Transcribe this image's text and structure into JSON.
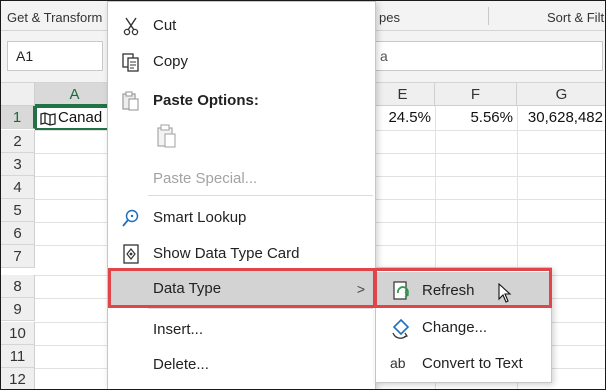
{
  "ribbon": {
    "groups": [
      "Get & Transform",
      "pes",
      "Sort & Filt"
    ]
  },
  "formula_bar": {
    "name_box": "A1",
    "formula_fragment": "a"
  },
  "sheet": {
    "columns": [
      "A",
      "E",
      "F",
      "G"
    ],
    "rows": [
      "1",
      "2",
      "3",
      "4",
      "5",
      "6",
      "7",
      "8",
      "9",
      "10",
      "11",
      "12"
    ],
    "active_cell": "A1",
    "row1": {
      "A": "Canad",
      "E": "24.5%",
      "F": "5.56%",
      "G": "30,628,482"
    }
  },
  "context_menu": {
    "items": [
      {
        "label": "Cut",
        "icon": "scissors-icon"
      },
      {
        "label": "Copy",
        "icon": "copy-icon"
      },
      {
        "label": "Paste Options:",
        "icon": "paste-icon"
      },
      {
        "label": "Paste Special...",
        "icon": "paste-special-icon"
      },
      {
        "label": "Smart Lookup",
        "icon": "smart-lookup-icon"
      },
      {
        "label": "Show Data Type Card",
        "icon": "data-type-card-icon"
      },
      {
        "label": "Data Type",
        "icon": ""
      },
      {
        "label": "Insert...",
        "icon": ""
      },
      {
        "label": "Delete...",
        "icon": ""
      }
    ],
    "submenu_chevron": ">"
  },
  "submenu": {
    "items": [
      {
        "label": "Refresh",
        "icon": "refresh-icon"
      },
      {
        "label": "Change...",
        "icon": "change-icon"
      },
      {
        "label": "Convert to Text",
        "icon": "convert-text-icon",
        "glyph": "ab"
      }
    ]
  },
  "colors": {
    "highlight_border": "#e0454a",
    "selection_green": "#217346",
    "hover_gray": "#d3d3d3"
  }
}
